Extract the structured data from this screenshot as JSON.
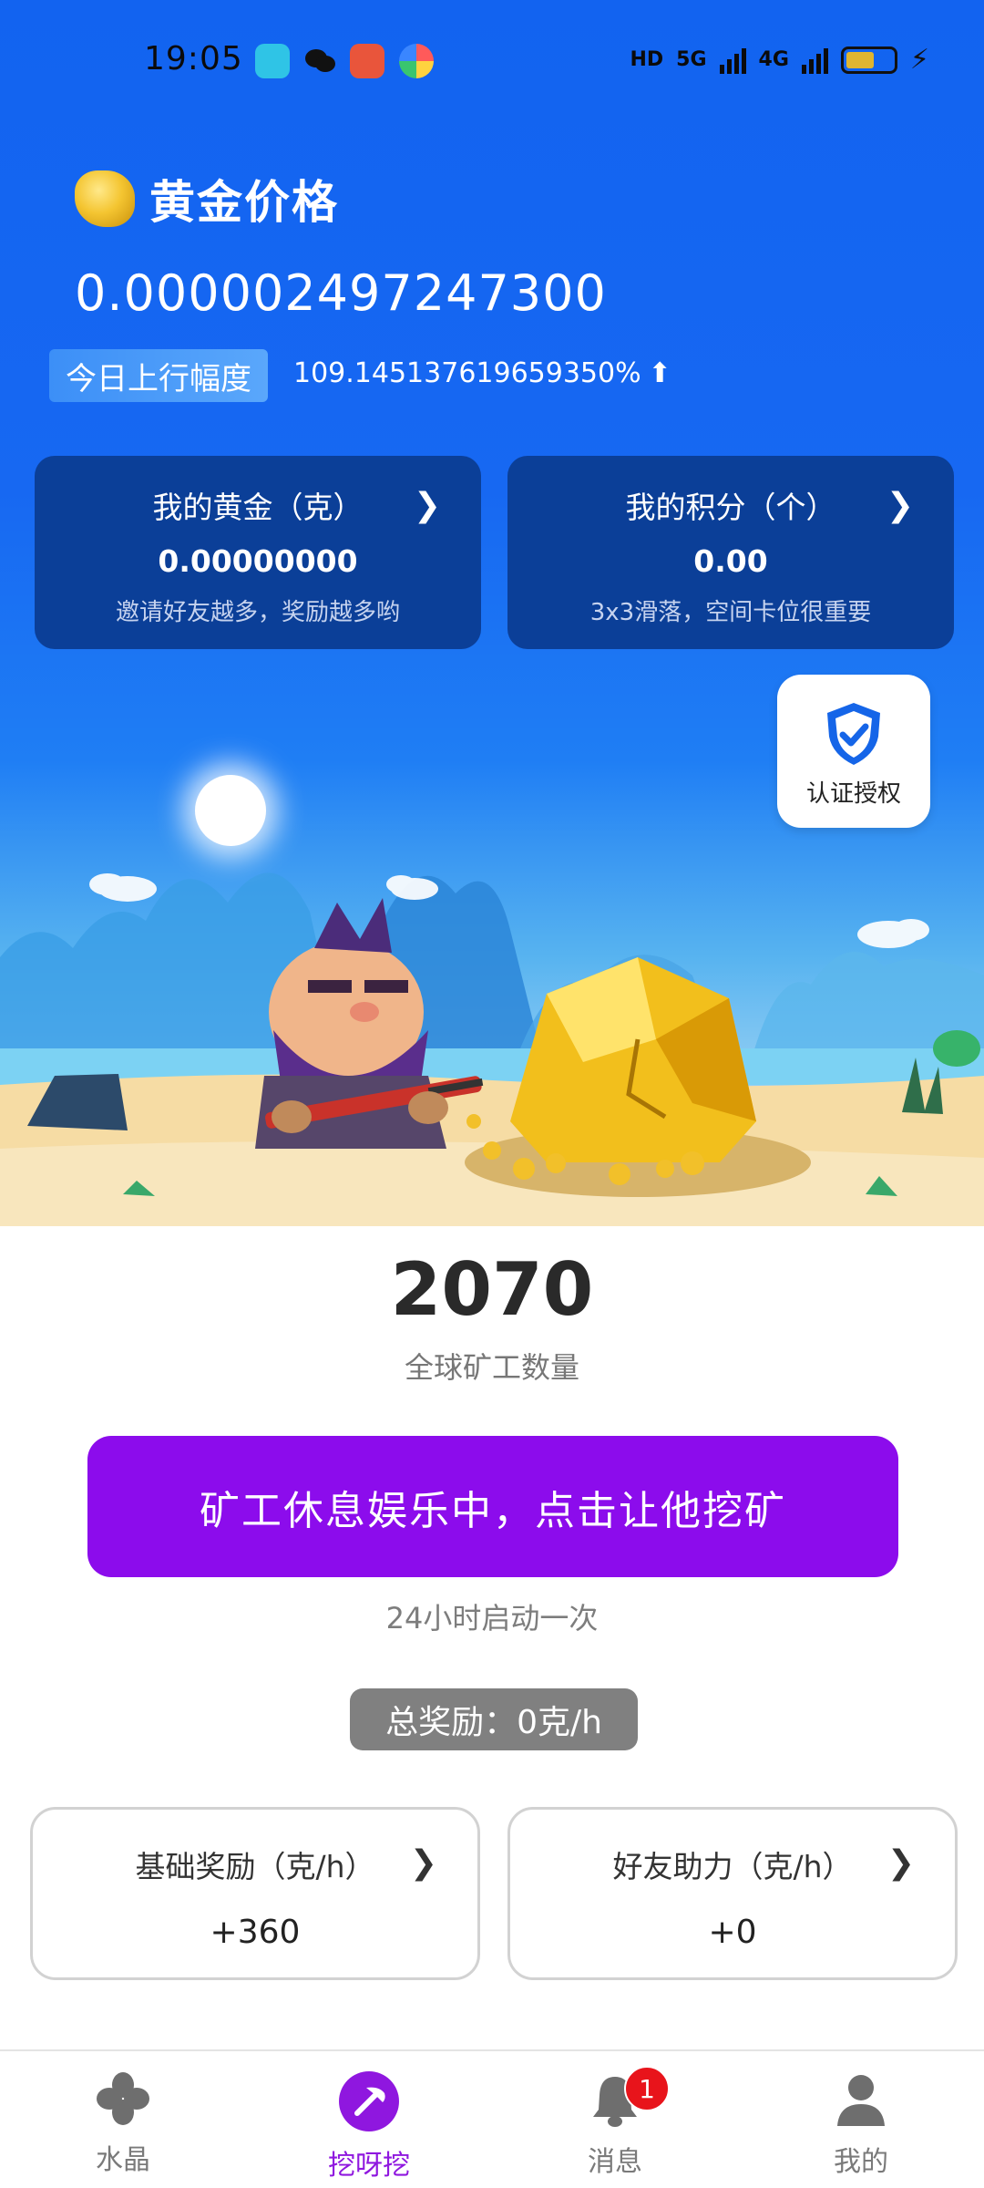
{
  "status_bar": {
    "time": "19:05",
    "network_1": "5G",
    "network_2": "4G",
    "hd_label": "HD"
  },
  "gold": {
    "title": "黄金价格",
    "price": "0.000002497247300",
    "rise_label": "今日上行幅度",
    "rise_value": "109.145137619659350%"
  },
  "cards": {
    "my_gold": {
      "title": "我的黄金（克）",
      "value": "0.00000000",
      "sub": "邀请好友越多，奖励越多哟"
    },
    "my_points": {
      "title": "我的积分（个）",
      "value": "0.00",
      "sub": "3x3滑落，空间卡位很重要"
    }
  },
  "auth": {
    "label": "认证授权"
  },
  "miners": {
    "count": "2070",
    "label": "全球矿工数量"
  },
  "mine_button": {
    "label": "矿工休息娱乐中，点击让他挖矿",
    "sub": "24小时启动一次"
  },
  "total_reward": "总奖励：0克/h",
  "rewards": {
    "base": {
      "title": "基础奖励（克/h）",
      "value": "+360"
    },
    "friend": {
      "title": "好友助力（克/h）",
      "value": "+0"
    }
  },
  "nav": {
    "items": [
      {
        "label": "水晶",
        "icon": "crystal-icon"
      },
      {
        "label": "挖呀挖",
        "icon": "pickaxe-icon"
      },
      {
        "label": "消息",
        "icon": "bell-icon",
        "badge": "1"
      },
      {
        "label": "我的",
        "icon": "person-icon"
      }
    ],
    "active_index": 1
  },
  "colors": {
    "hero_blue": "#1263f0",
    "card_navy": "#0b3f98",
    "mine_purple": "#8c0cec",
    "active_nav": "#8f17df",
    "badge_red": "#e8141b"
  }
}
